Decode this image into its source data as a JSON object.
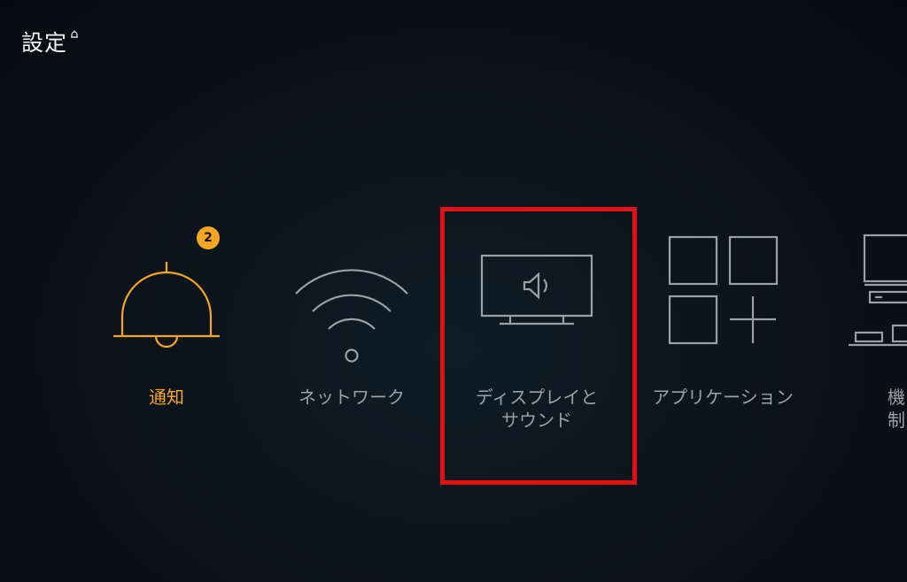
{
  "header": {
    "title": "設定"
  },
  "colors": {
    "accent": "#f6a623",
    "inactive": "#9aa1a6",
    "highlight": "#e41010"
  },
  "menu": {
    "items": [
      {
        "label": "通知",
        "icon": "bell-icon",
        "badge": "2",
        "active": true
      },
      {
        "label": "ネットワーク",
        "icon": "wifi-icon"
      },
      {
        "label": "ディスプレイと\nサウンド",
        "icon": "tv-speaker-icon"
      },
      {
        "label": "アプリケーション",
        "icon": "apps-grid-icon"
      },
      {
        "label": "機\n制",
        "icon": "devices-icon"
      }
    ]
  }
}
